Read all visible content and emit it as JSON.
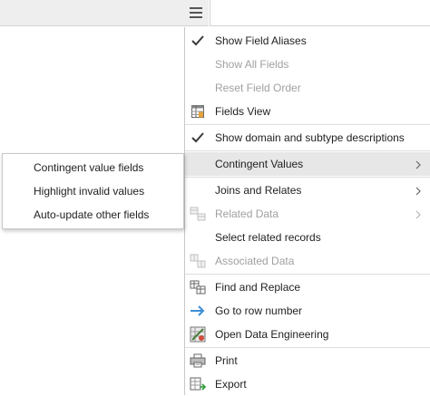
{
  "menu": {
    "sections": [
      [
        {
          "label": "Show Field Aliases",
          "icon": "checkmark-icon",
          "checked": true,
          "disabled": false
        },
        {
          "label": "Show All Fields",
          "icon": "",
          "disabled": true
        },
        {
          "label": "Reset Field Order",
          "icon": "",
          "disabled": true
        },
        {
          "label": "Fields View",
          "icon": "fields-view-icon",
          "disabled": false
        }
      ],
      [
        {
          "label": "Show domain and subtype descriptions",
          "icon": "checkmark-icon",
          "checked": true,
          "disabled": false
        }
      ],
      [
        {
          "label": "Contingent Values",
          "icon": "",
          "disabled": false,
          "submenu": true,
          "highlighted": true
        }
      ],
      [
        {
          "label": "Joins and Relates",
          "icon": "",
          "disabled": false,
          "submenu": true
        },
        {
          "label": "Related Data",
          "icon": "related-data-icon",
          "disabled": true,
          "submenu": true
        },
        {
          "label": "Select related records",
          "icon": "",
          "disabled": false
        },
        {
          "label": "Associated Data",
          "icon": "associated-data-icon",
          "disabled": true
        }
      ],
      [
        {
          "label": "Find and Replace",
          "icon": "find-replace-icon",
          "disabled": false
        },
        {
          "label": "Go to row number",
          "icon": "arrow-right-icon",
          "disabled": false
        },
        {
          "label": "Open Data Engineering",
          "icon": "data-engineering-icon",
          "disabled": false
        }
      ],
      [
        {
          "label": "Print",
          "icon": "printer-icon",
          "disabled": false
        },
        {
          "label": "Export",
          "icon": "export-icon",
          "disabled": false
        }
      ]
    ]
  },
  "submenu": {
    "items": [
      {
        "label": "Contingent value fields"
      },
      {
        "label": "Highlight invalid values"
      },
      {
        "label": "Auto-update other fields"
      }
    ]
  },
  "colors": {
    "check": "#3b3b3b",
    "arrow": "#3d8fd4",
    "disabled_text": "#a0a0a0",
    "highlight": "#e7e7e7"
  }
}
